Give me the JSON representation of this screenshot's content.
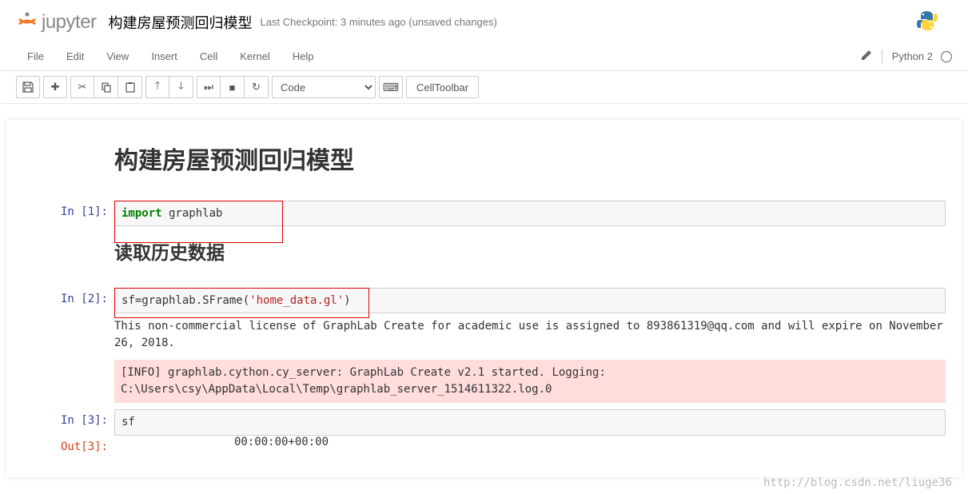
{
  "header": {
    "logo_text": "jupyter",
    "notebook_title": "构建房屋预测回归模型",
    "checkpoint": "Last Checkpoint: 3 minutes ago (unsaved changes)"
  },
  "menubar": {
    "file": "File",
    "edit": "Edit",
    "view": "View",
    "insert": "Insert",
    "cell": "Cell",
    "kernel": "Kernel",
    "help": "Help",
    "kernel_name": "Python 2"
  },
  "toolbar": {
    "cell_type": "Code",
    "celltoolbar": "CellToolbar"
  },
  "cells": {
    "heading1": "构建房屋预测回归模型",
    "heading2": "读取历史数据",
    "in1_prompt": "In [1]:",
    "in1_code_kw": "import",
    "in1_code_rest": " graphlab",
    "in2_prompt": "In [2]:",
    "in2_code_pre": "sf=graphlab.SFrame(",
    "in2_code_str": "'home_data.gl'",
    "in2_code_post": ")",
    "in2_out_text": "This non-commercial license of GraphLab Create for academic use is assigned to 893861319@qq.com and will expire on November 26, 2018.",
    "in2_out_stderr": "[INFO] graphlab.cython.cy_server: GraphLab Create v2.1 started. Logging: C:\\Users\\csy\\AppData\\Local\\Temp\\graphlab_server_1514611322.log.0",
    "in3_prompt": "In [3]:",
    "in3_code": "sf",
    "out3_prompt": "Out[3]:",
    "out3_time": "00:00:00+00:00"
  },
  "watermark": "http://blog.csdn.net/liuge36"
}
